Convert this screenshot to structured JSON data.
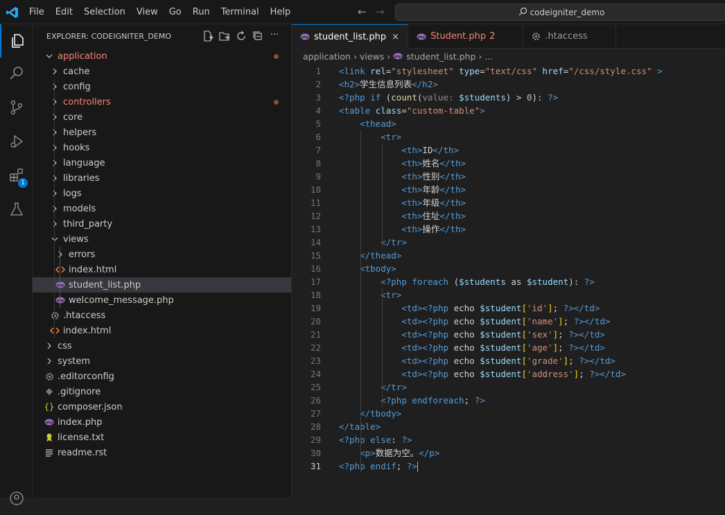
{
  "menu": [
    "File",
    "Edit",
    "Selection",
    "View",
    "Go",
    "Run",
    "Terminal",
    "Help"
  ],
  "search": {
    "label": "codeigniter_demo"
  },
  "activity": {
    "extensions_badge": "1"
  },
  "explorer": {
    "title": "EXPLORER: CODEIGNITER_DEMO"
  },
  "tree": [
    {
      "label": "application",
      "depth": 0,
      "kind": "folder-open",
      "color": "#f48771",
      "modified": true
    },
    {
      "label": "cache",
      "depth": 1,
      "kind": "folder"
    },
    {
      "label": "config",
      "depth": 1,
      "kind": "folder"
    },
    {
      "label": "controllers",
      "depth": 1,
      "kind": "folder",
      "color": "#f48771",
      "modified": true
    },
    {
      "label": "core",
      "depth": 1,
      "kind": "folder"
    },
    {
      "label": "helpers",
      "depth": 1,
      "kind": "folder"
    },
    {
      "label": "hooks",
      "depth": 1,
      "kind": "folder"
    },
    {
      "label": "language",
      "depth": 1,
      "kind": "folder"
    },
    {
      "label": "libraries",
      "depth": 1,
      "kind": "folder"
    },
    {
      "label": "logs",
      "depth": 1,
      "kind": "folder"
    },
    {
      "label": "models",
      "depth": 1,
      "kind": "folder"
    },
    {
      "label": "third_party",
      "depth": 1,
      "kind": "folder"
    },
    {
      "label": "views",
      "depth": 1,
      "kind": "folder-open"
    },
    {
      "label": "errors",
      "depth": 2,
      "kind": "folder"
    },
    {
      "label": "index.html",
      "depth": 2,
      "kind": "html"
    },
    {
      "label": "student_list.php",
      "depth": 2,
      "kind": "php",
      "selected": true
    },
    {
      "label": "welcome_message.php",
      "depth": 2,
      "kind": "php"
    },
    {
      "label": ".htaccess",
      "depth": 1,
      "kind": "gear"
    },
    {
      "label": "index.html",
      "depth": 1,
      "kind": "html"
    },
    {
      "label": "css",
      "depth": 0,
      "kind": "folder"
    },
    {
      "label": "system",
      "depth": 0,
      "kind": "folder"
    },
    {
      "label": ".editorconfig",
      "depth": 0,
      "kind": "gear"
    },
    {
      "label": ".gitignore",
      "depth": 0,
      "kind": "git"
    },
    {
      "label": "composer.json",
      "depth": 0,
      "kind": "json"
    },
    {
      "label": "index.php",
      "depth": 0,
      "kind": "php"
    },
    {
      "label": "license.txt",
      "depth": 0,
      "kind": "license"
    },
    {
      "label": "readme.rst",
      "depth": 0,
      "kind": "text"
    }
  ],
  "tabs": [
    {
      "label": "student_list.php",
      "icon": "php",
      "active": true,
      "close": "×"
    },
    {
      "label": "Student.php",
      "icon": "php",
      "problems": "2",
      "color": "#f48771"
    },
    {
      "label": ".htaccess",
      "icon": "gear"
    }
  ],
  "breadcrumbs": [
    "application",
    "views",
    "student_list.php",
    "..."
  ],
  "code_lines": [
    [
      [
        "t",
        "<link "
      ],
      [
        "a",
        "rel"
      ],
      [
        "w",
        "="
      ],
      [
        "s",
        "\"stylesheet\""
      ],
      [
        "w",
        " "
      ],
      [
        "a",
        "type"
      ],
      [
        "w",
        "="
      ],
      [
        "s",
        "\"text/css\""
      ],
      [
        "w",
        " "
      ],
      [
        "a",
        "href"
      ],
      [
        "w",
        "="
      ],
      [
        "s",
        "\"/css/style.css\""
      ],
      [
        "w",
        " "
      ],
      [
        "t",
        ">"
      ]
    ],
    [
      [
        "t",
        "<h2>"
      ],
      [
        "w",
        "学生信息列表"
      ],
      [
        "t",
        "</h2>"
      ]
    ],
    [
      [
        "k",
        "<?php "
      ],
      [
        "k",
        "if "
      ],
      [
        "w",
        "("
      ],
      [
        "f",
        "count"
      ],
      [
        "w",
        "("
      ],
      [
        "h",
        "value: "
      ],
      [
        "v",
        "$students"
      ],
      [
        "w",
        ") > "
      ],
      [
        "n",
        "0"
      ],
      [
        "w",
        "): "
      ],
      [
        "k",
        "?>"
      ]
    ],
    [
      [
        "t",
        "<table "
      ],
      [
        "a",
        "class"
      ],
      [
        "w",
        "="
      ],
      [
        "s",
        "\"custom-table\""
      ],
      [
        "t",
        ">"
      ]
    ],
    [
      [
        "w",
        "    "
      ],
      [
        "t",
        "<thead>"
      ]
    ],
    [
      [
        "w",
        "        "
      ],
      [
        "t",
        "<tr>"
      ]
    ],
    [
      [
        "w",
        "            "
      ],
      [
        "t",
        "<th>"
      ],
      [
        "w",
        "ID"
      ],
      [
        "t",
        "</th>"
      ]
    ],
    [
      [
        "w",
        "            "
      ],
      [
        "t",
        "<th>"
      ],
      [
        "w",
        "姓名"
      ],
      [
        "t",
        "</th>"
      ]
    ],
    [
      [
        "w",
        "            "
      ],
      [
        "t",
        "<th>"
      ],
      [
        "w",
        "性别"
      ],
      [
        "t",
        "</th>"
      ]
    ],
    [
      [
        "w",
        "            "
      ],
      [
        "t",
        "<th>"
      ],
      [
        "w",
        "年龄"
      ],
      [
        "t",
        "</th>"
      ]
    ],
    [
      [
        "w",
        "            "
      ],
      [
        "t",
        "<th>"
      ],
      [
        "w",
        "年级"
      ],
      [
        "t",
        "</th>"
      ]
    ],
    [
      [
        "w",
        "            "
      ],
      [
        "t",
        "<th>"
      ],
      [
        "w",
        "住址"
      ],
      [
        "t",
        "</th>"
      ]
    ],
    [
      [
        "w",
        "            "
      ],
      [
        "t",
        "<th>"
      ],
      [
        "w",
        "操作"
      ],
      [
        "t",
        "</th>"
      ]
    ],
    [
      [
        "w",
        "        "
      ],
      [
        "t",
        "</tr>"
      ]
    ],
    [
      [
        "w",
        "    "
      ],
      [
        "t",
        "</thead>"
      ]
    ],
    [
      [
        "w",
        "    "
      ],
      [
        "t",
        "<tbody>"
      ]
    ],
    [
      [
        "w",
        "        "
      ],
      [
        "k",
        "<?php "
      ],
      [
        "k",
        "foreach "
      ],
      [
        "w",
        "("
      ],
      [
        "v",
        "$students"
      ],
      [
        "w",
        " as "
      ],
      [
        "v",
        "$student"
      ],
      [
        "w",
        "): "
      ],
      [
        "k",
        "?>"
      ]
    ],
    [
      [
        "w",
        "        "
      ],
      [
        "t",
        "<tr>"
      ]
    ],
    [
      [
        "w",
        "            "
      ],
      [
        "t",
        "<td>"
      ],
      [
        "k",
        "<?php "
      ],
      [
        "w",
        "echo "
      ],
      [
        "v",
        "$student"
      ],
      [
        "y",
        "["
      ],
      [
        "s",
        "'id'"
      ],
      [
        "y",
        "]"
      ],
      [
        "w",
        "; "
      ],
      [
        "k",
        "?>"
      ],
      [
        "t",
        "</td>"
      ]
    ],
    [
      [
        "w",
        "            "
      ],
      [
        "t",
        "<td>"
      ],
      [
        "k",
        "<?php "
      ],
      [
        "w",
        "echo "
      ],
      [
        "v",
        "$student"
      ],
      [
        "y",
        "["
      ],
      [
        "s",
        "'name'"
      ],
      [
        "y",
        "]"
      ],
      [
        "w",
        "; "
      ],
      [
        "k",
        "?>"
      ],
      [
        "t",
        "</td>"
      ]
    ],
    [
      [
        "w",
        "            "
      ],
      [
        "t",
        "<td>"
      ],
      [
        "k",
        "<?php "
      ],
      [
        "w",
        "echo "
      ],
      [
        "v",
        "$student"
      ],
      [
        "y",
        "["
      ],
      [
        "s",
        "'sex'"
      ],
      [
        "y",
        "]"
      ],
      [
        "w",
        "; "
      ],
      [
        "k",
        "?>"
      ],
      [
        "t",
        "</td>"
      ]
    ],
    [
      [
        "w",
        "            "
      ],
      [
        "t",
        "<td>"
      ],
      [
        "k",
        "<?php "
      ],
      [
        "w",
        "echo "
      ],
      [
        "v",
        "$student"
      ],
      [
        "y",
        "["
      ],
      [
        "s",
        "'age'"
      ],
      [
        "y",
        "]"
      ],
      [
        "w",
        "; "
      ],
      [
        "k",
        "?>"
      ],
      [
        "t",
        "</td>"
      ]
    ],
    [
      [
        "w",
        "            "
      ],
      [
        "t",
        "<td>"
      ],
      [
        "k",
        "<?php "
      ],
      [
        "w",
        "echo "
      ],
      [
        "v",
        "$student"
      ],
      [
        "y",
        "["
      ],
      [
        "s",
        "'grade'"
      ],
      [
        "y",
        "]"
      ],
      [
        "w",
        "; "
      ],
      [
        "k",
        "?>"
      ],
      [
        "t",
        "</td>"
      ]
    ],
    [
      [
        "w",
        "            "
      ],
      [
        "t",
        "<td>"
      ],
      [
        "k",
        "<?php "
      ],
      [
        "w",
        "echo "
      ],
      [
        "v",
        "$student"
      ],
      [
        "y",
        "["
      ],
      [
        "s",
        "'address'"
      ],
      [
        "y",
        "]"
      ],
      [
        "w",
        "; "
      ],
      [
        "k",
        "?>"
      ],
      [
        "t",
        "</td>"
      ]
    ],
    [
      [
        "w",
        "        "
      ],
      [
        "t",
        "</tr>"
      ]
    ],
    [
      [
        "w",
        "        "
      ],
      [
        "k",
        "<?php "
      ],
      [
        "k",
        "endforeach"
      ],
      [
        "w",
        "; "
      ],
      [
        "k",
        "?>"
      ]
    ],
    [
      [
        "w",
        "    "
      ],
      [
        "t",
        "</tbody>"
      ]
    ],
    [
      [
        "t",
        "</table>"
      ]
    ],
    [
      [
        "k",
        "<?php "
      ],
      [
        "k",
        "else"
      ],
      [
        "w",
        ": "
      ],
      [
        "k",
        "?>"
      ]
    ],
    [
      [
        "w",
        "    "
      ],
      [
        "t",
        "<p>"
      ],
      [
        "w",
        "数据为空。"
      ],
      [
        "t",
        "</p>"
      ]
    ],
    [
      [
        "k",
        "<?php "
      ],
      [
        "k",
        "endif"
      ],
      [
        "w",
        "; "
      ],
      [
        "k",
        "?>"
      ]
    ]
  ],
  "cursor_line": 31,
  "colors": {
    "accent": "#0078d4",
    "modified": "#f48771",
    "php_icon": "#a074c4",
    "html_icon": "#e37933"
  }
}
